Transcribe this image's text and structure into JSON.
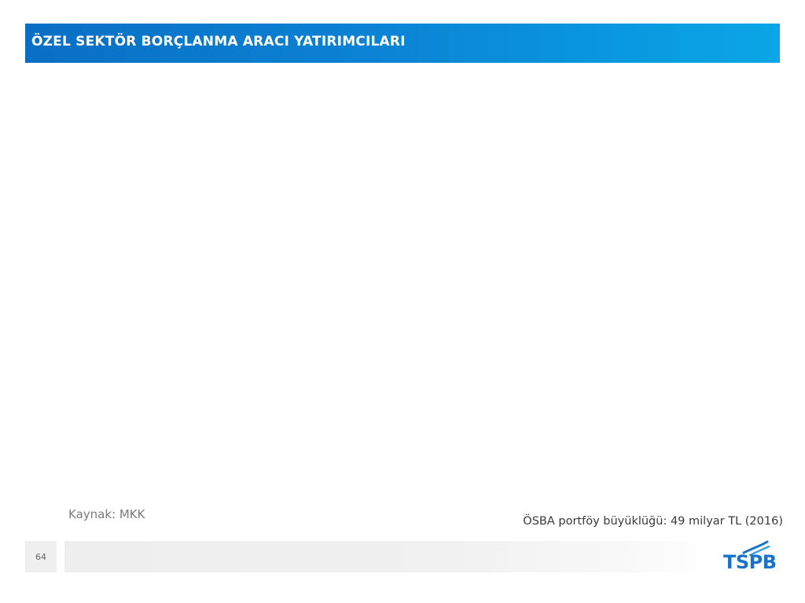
{
  "slide": {
    "title": "ÖZEL SEKTÖR BORÇLANMA ARACI YATIRIMCILARI",
    "source_note": "Kaynak: MKK",
    "portfolio_note": "ÖSBA portföy büyüklüğü: 49 milyar TL (2016)",
    "page_number": "64"
  },
  "logo": {
    "text": "TSPB",
    "color": "#1a73c9"
  },
  "colors": {
    "title_bar_start": "#0a6fc4",
    "title_bar_end": "#0aa6e6",
    "title_text": "#ffffff"
  }
}
